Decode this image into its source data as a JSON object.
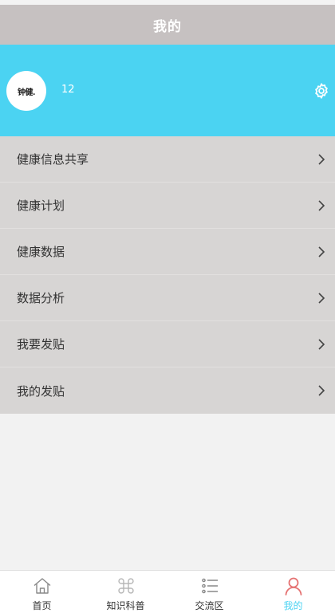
{
  "header": {
    "title": "我的"
  },
  "profile": {
    "avatar_text": "钟健.",
    "username": "12",
    "settings_icon": "gear-icon"
  },
  "menu": [
    {
      "label": "健康信息共享"
    },
    {
      "label": "健康计划"
    },
    {
      "label": "健康数据"
    },
    {
      "label": "数据分析"
    },
    {
      "label": "我要发贴"
    },
    {
      "label": "我的发贴"
    }
  ],
  "tabbar": {
    "active": "我的",
    "tabs": [
      {
        "label": "首页",
        "icon": "home-icon"
      },
      {
        "label": "知识科普",
        "icon": "command-icon"
      },
      {
        "label": "交流区",
        "icon": "list-icon"
      },
      {
        "label": "我的",
        "icon": "person-icon"
      }
    ]
  },
  "colors": {
    "header_bg": "#c6c1c1",
    "profile_bg": "#4bd3f2",
    "menu_bg": "#d7d5d4",
    "active_tab_label": "#4bd3f2",
    "active_tab_icon": "#e57373"
  }
}
